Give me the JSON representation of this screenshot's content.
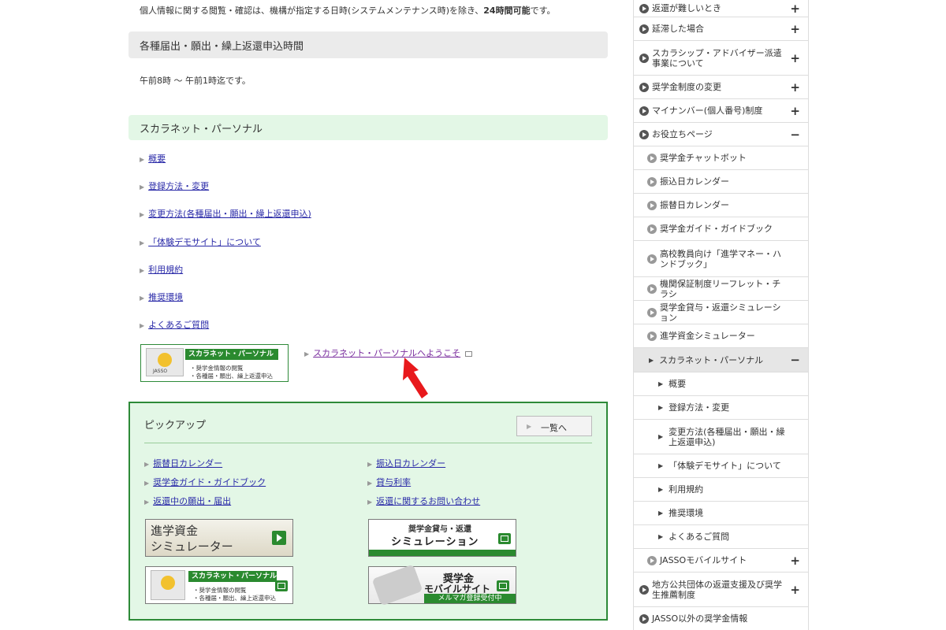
{
  "intro": {
    "before": "個人情報に関する閲覧・確認は、機構が指定する日時(システムメンテナンス時)を除き、",
    "bold": "24時間可能",
    "after": "です。"
  },
  "hours_heading": "各種届出・願出・繰上返還申込時間",
  "hours_text": "午前8時 〜 午前1時迄です。",
  "sp_heading": "スカラネット・パーソナル",
  "sp_links": [
    "概要",
    "登録方法・変更",
    "変更方法(各種届出・願出・繰上返還申込)",
    "「体験デモサイト」について",
    "利用規約",
    "推奨環境",
    "よくあるご質問"
  ],
  "sp_banner": {
    "title": "スカラネット・パーソナル",
    "line1": "・奨学金情報の閲覧",
    "line2": "・各種届・願出、繰上返還申込",
    "logo_text": "JASSO"
  },
  "welcome_link": "スカラネット・パーソナルへようこそ",
  "pickup": {
    "title": "ピックアップ",
    "list_button": "一覧へ",
    "left_links": [
      "振替日カレンダー",
      "奨学金ガイド・ガイドブック",
      "返還中の願出・届出"
    ],
    "right_links": [
      "振込日カレンダー",
      "貸与利率",
      "返還に関するお問い合わせ"
    ],
    "banner_sim": {
      "line1": "進学資金",
      "line2": "シミュレーター"
    },
    "banner_loan": {
      "line1": "奨学金貸与・返還",
      "line2": "シミュレーション"
    },
    "banner_sp": {
      "title": "スカラネット・パーソナル",
      "line1": "・奨学金情報の閲覧",
      "line2": "・各種届・願出、繰上返還申込"
    },
    "banner_mobile": {
      "line1": "奨学金",
      "line2": "モバイルサイト",
      "line3": "メルマガ登録受付中"
    }
  },
  "sidebar": [
    {
      "label": "返還が難しいとき",
      "lvl": 1,
      "pm": "+",
      "h": 22
    },
    {
      "label": "延滞した場合",
      "lvl": 1,
      "pm": "+",
      "h": 30
    },
    {
      "label": "スカラシップ・アドバイザー派遣事業について",
      "lvl": 1,
      "pm": "+",
      "h": 44
    },
    {
      "label": "奨学金制度の変更",
      "lvl": 1,
      "pm": "+",
      "h": 30
    },
    {
      "label": "マイナンバー(個人番号)制度",
      "lvl": 1,
      "pm": "+",
      "h": 30
    },
    {
      "label": "お役立ちページ",
      "lvl": 1,
      "pm": "−",
      "h": 30
    },
    {
      "label": "奨学金チャットボット",
      "lvl": 2,
      "pm": "",
      "h": 30
    },
    {
      "label": "振込日カレンダー",
      "lvl": 2,
      "pm": "",
      "h": 30
    },
    {
      "label": "振替日カレンダー",
      "lvl": 2,
      "pm": "",
      "h": 30
    },
    {
      "label": "奨学金ガイド・ガイドブック",
      "lvl": 2,
      "pm": "",
      "h": 30
    },
    {
      "label": "高校教員向け「進学マネー・ハンドブック」",
      "lvl": 2,
      "pm": "",
      "h": 46
    },
    {
      "label": "機関保証制度リーフレット・チラシ",
      "lvl": 2,
      "pm": "",
      "h": 30
    },
    {
      "label": "奨学金貸与・返還シミュレーション",
      "lvl": 2,
      "pm": "",
      "h": 30
    },
    {
      "label": "進学資金シミュレーター",
      "lvl": 2,
      "pm": "",
      "h": 30
    },
    {
      "label": "スカラネット・パーソナル",
      "lvl": 2,
      "pm": "−",
      "h": 31,
      "active": true
    },
    {
      "label": "概要",
      "lvl": 3,
      "pm": "",
      "h": 30
    },
    {
      "label": "登録方法・変更",
      "lvl": 3,
      "pm": "",
      "h": 30
    },
    {
      "label": "変更方法(各種届出・願出・繰上返還申込)",
      "lvl": 3,
      "pm": "",
      "h": 44
    },
    {
      "label": "「体験デモサイト」について",
      "lvl": 3,
      "pm": "",
      "h": 30
    },
    {
      "label": "利用規約",
      "lvl": 3,
      "pm": "",
      "h": 30
    },
    {
      "label": "推奨環境",
      "lvl": 3,
      "pm": "",
      "h": 30
    },
    {
      "label": "よくあるご質問",
      "lvl": 3,
      "pm": "",
      "h": 30
    },
    {
      "label": "JASSOモバイルサイト",
      "lvl": 2,
      "pm": "+",
      "h": 30
    },
    {
      "label": "地方公共団体の返還支援及び奨学生推薦制度",
      "lvl": 1,
      "pm": "+",
      "h": 44
    },
    {
      "label": "JASSO以外の奨学金情報",
      "lvl": 1,
      "pm": "",
      "h": 30
    }
  ]
}
